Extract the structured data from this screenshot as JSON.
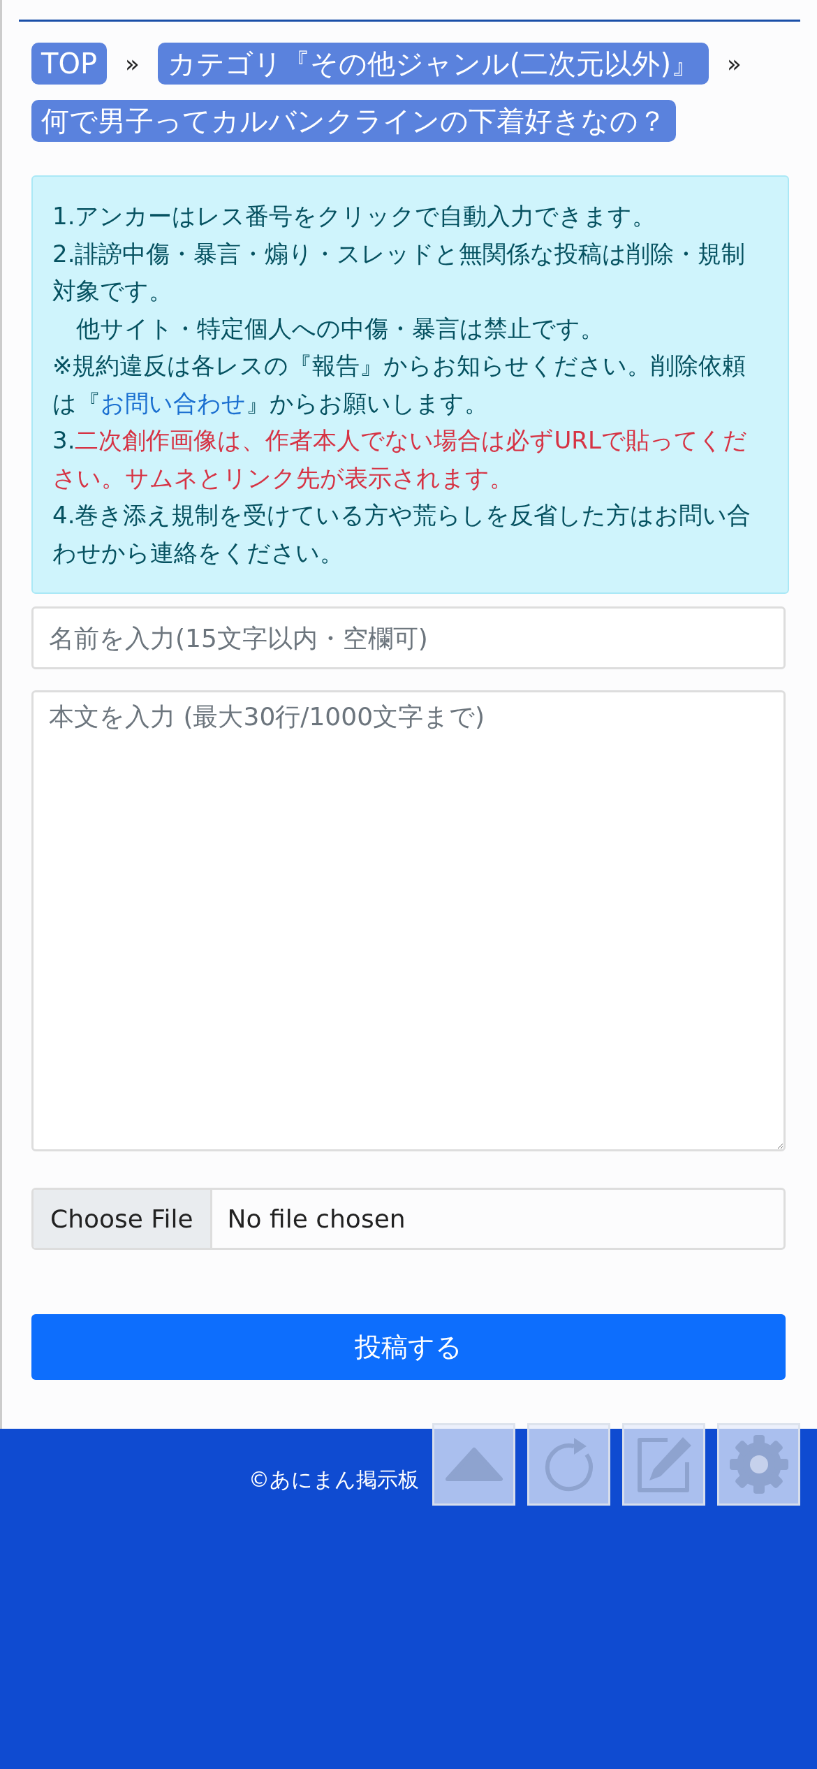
{
  "breadcrumb": [
    {
      "label": "TOP",
      "separator": "»"
    },
    {
      "label": "カテゴリ『その他ジャンル(二次元以外)』",
      "separator": "»"
    },
    {
      "label": "何で男子ってカルバンクラインの下着好きなの？"
    }
  ],
  "notices": [
    {
      "kind": "text",
      "text": "1.アンカーはレス番号をクリックで自動入力できます。"
    },
    {
      "kind": "text",
      "text": "2.誹謗中傷・暴言・煽り・スレッドと無関係な投稿は削除・規制対象です。"
    },
    {
      "kind": "text",
      "text": "　他サイト・特定個人への中傷・暴言は禁止です。"
    },
    {
      "kind": "link",
      "before": "※規約違反は各レスの『報告』からお知らせください。削除依頼は『",
      "link": "お問い合わせ",
      "after": "』からお願いします。"
    },
    {
      "kind": "warning",
      "number": "3.",
      "text": "二次創作画像は、作者本人でない場合は必ずURLで貼ってください。サムネとリンク先が表示されます。"
    },
    {
      "kind": "text",
      "text": "4.巻き添え規制を受けている方や荒らしを反省した方はお問い合わせから連絡をください。"
    }
  ],
  "form": {
    "name_placeholder": "名前を入力(15文字以内・空欄可)",
    "body_placeholder": "本文を入力 (最大30行/1000文字まで)",
    "file_button": "Choose File",
    "file_status": "No file chosen",
    "submit": "投稿する"
  },
  "footer": {
    "copyright": "©あにまん掲示板"
  }
}
